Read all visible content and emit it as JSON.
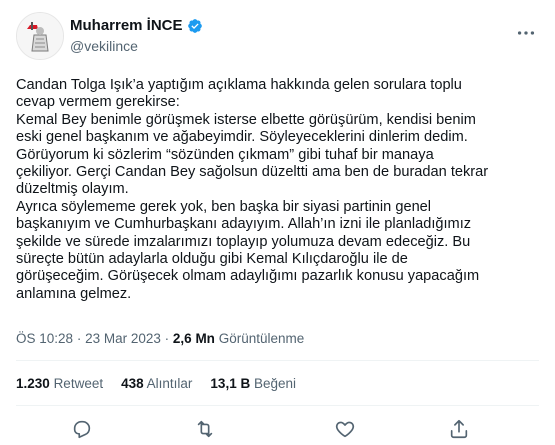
{
  "tweet": {
    "author": {
      "name": "Muharrem İNCE",
      "handle": "@vekilince",
      "verified": true
    },
    "text": "Candan Tolga Işık’a yaptığım açıklama hakkında gelen sorulara toplu\ncevap vermem gerekirse:\nKemal Bey benimle görüşmek isterse elbette görüşürüm, kendisi benim\neski genel başkanım ve ağabeyimdir. Söyleyeceklerini dinlerim dedim.\nGörüyorum ki sözlerim “sözünden çıkmam” gibi tuhaf bir manaya\nçekiliyor. Gerçi Candan Bey sağolsun düzeltti ama ben de buradan tekrar\ndüzeltmiş olayım.\nAyrıca söylememe gerek yok, ben başka bir siyasi partinin genel\nbaşkanıyım ve Cumhurbaşkanı adayıyım. Allah’ın izni ile planladığımız\nşekilde ve sürede imzalarımızı toplayıp yolumuza devam edeceğiz. Bu\nsüreçte bütün adaylarla olduğu gibi Kemal Kılıçdaroğlu ile de\ngörüşeceğim. Görüşecek olmam adaylığımı pazarlık konusu yapacağım\nanlamına gelmez.",
    "time": "ÖS 10:28",
    "separator": "·",
    "date": "23 Mar 2023",
    "views_count": "2,6 Mn",
    "views_label": "Görüntülenme",
    "stats": {
      "retweets_count": "1.230",
      "retweets_label": "Retweet",
      "quotes_count": "438",
      "quotes_label": "Alıntılar",
      "likes_count": "13,1 B",
      "likes_label": "Beğeni"
    }
  },
  "colors": {
    "text": "#0f1419",
    "secondary": "#536471",
    "verified": "#1d9bf0",
    "divider": "#eff3f4"
  },
  "icons": [
    "verified-badge-icon",
    "more-icon",
    "reply-icon",
    "retweet-icon",
    "like-icon",
    "share-icon"
  ]
}
